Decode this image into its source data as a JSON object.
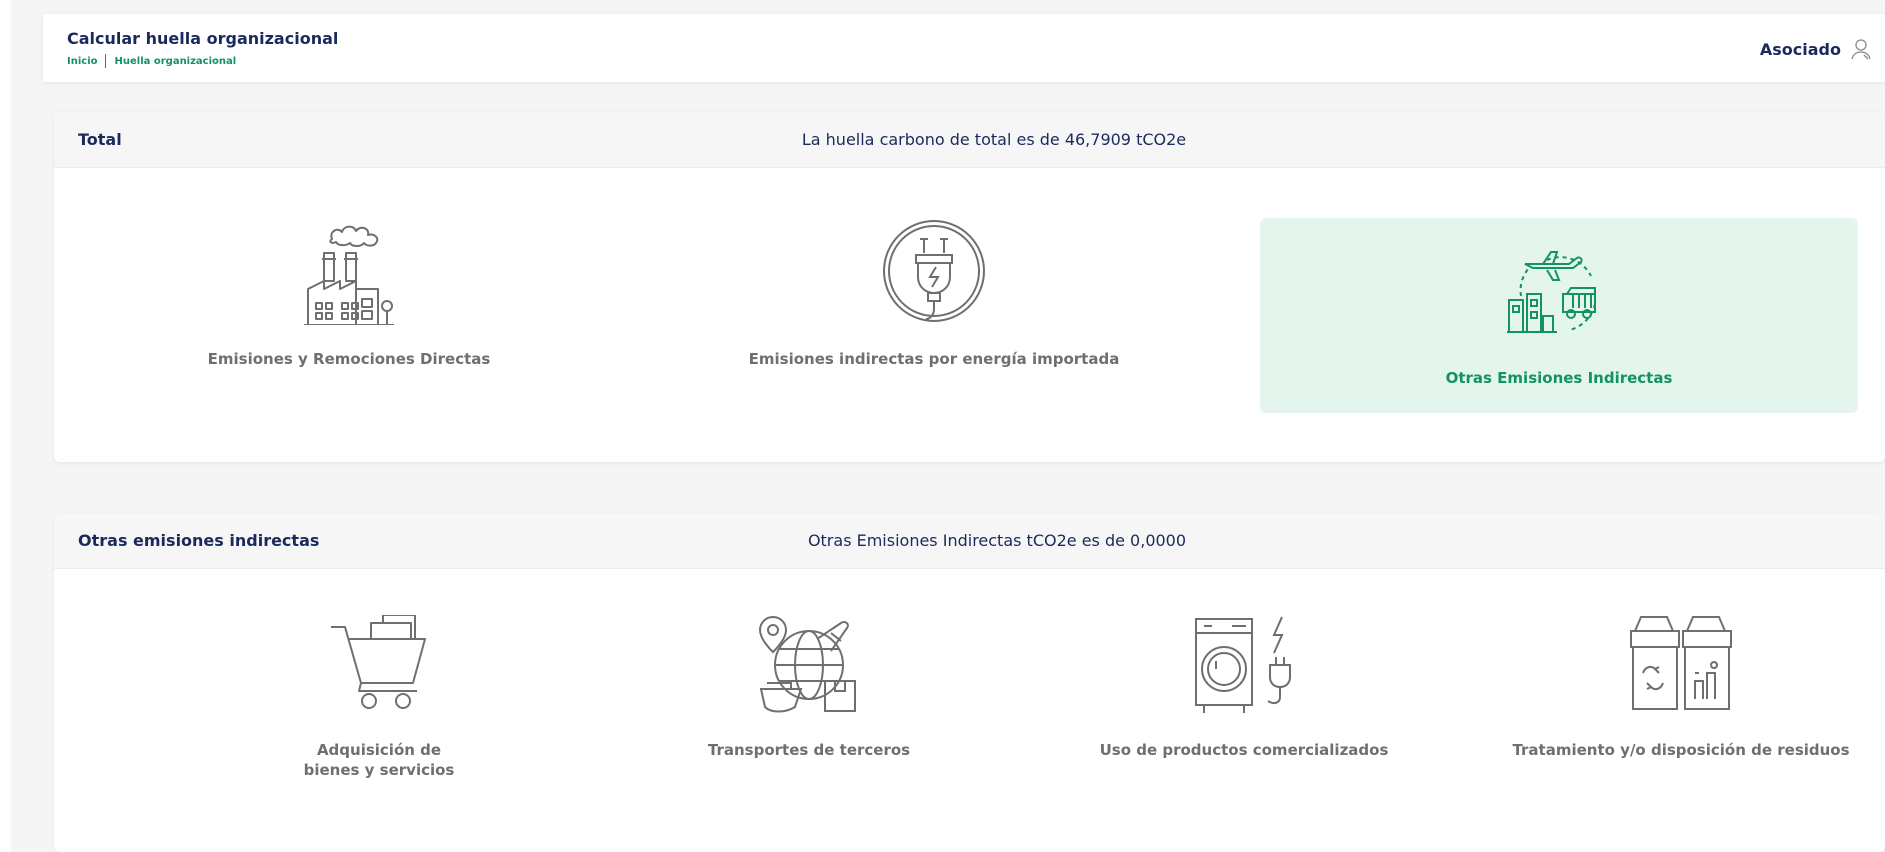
{
  "header": {
    "title": "Calcular huella organizacional",
    "breadcrumb": [
      "Inicio",
      "Huella organizacional"
    ],
    "user": "Asociado"
  },
  "total": {
    "title": "Total",
    "info": "La huella carbono de total es de 46,7909 tCO2e",
    "tiles": [
      {
        "label": "Emisiones y Remociones Directas",
        "icon": "factory-icon",
        "selected": false
      },
      {
        "label": "Emisiones indirectas por energía importada",
        "icon": "plug-icon",
        "selected": false
      },
      {
        "label": "Otras Emisiones Indirectas",
        "icon": "transport-cycle-icon",
        "selected": true
      }
    ]
  },
  "otras": {
    "title": "Otras emisiones indirectas",
    "info": "Otras Emisiones Indirectas tCO2e es de 0,0000",
    "tiles": [
      {
        "label_line1": "Adquisición de",
        "label_line2": "bienes y servicios",
        "icon": "shopping-cart-icon"
      },
      {
        "label": "Transportes de terceros",
        "icon": "globe-transport-icon"
      },
      {
        "label": "Uso de productos comercializados",
        "icon": "washing-machine-icon"
      },
      {
        "label": "Tratamiento y/o disposición de residuos",
        "icon": "waste-bins-icon"
      }
    ]
  },
  "colors": {
    "navy": "#1b2a5c",
    "green": "#13935f",
    "selected_bg": "#e4f5ee",
    "icon_gray": "#6f6f6f"
  }
}
